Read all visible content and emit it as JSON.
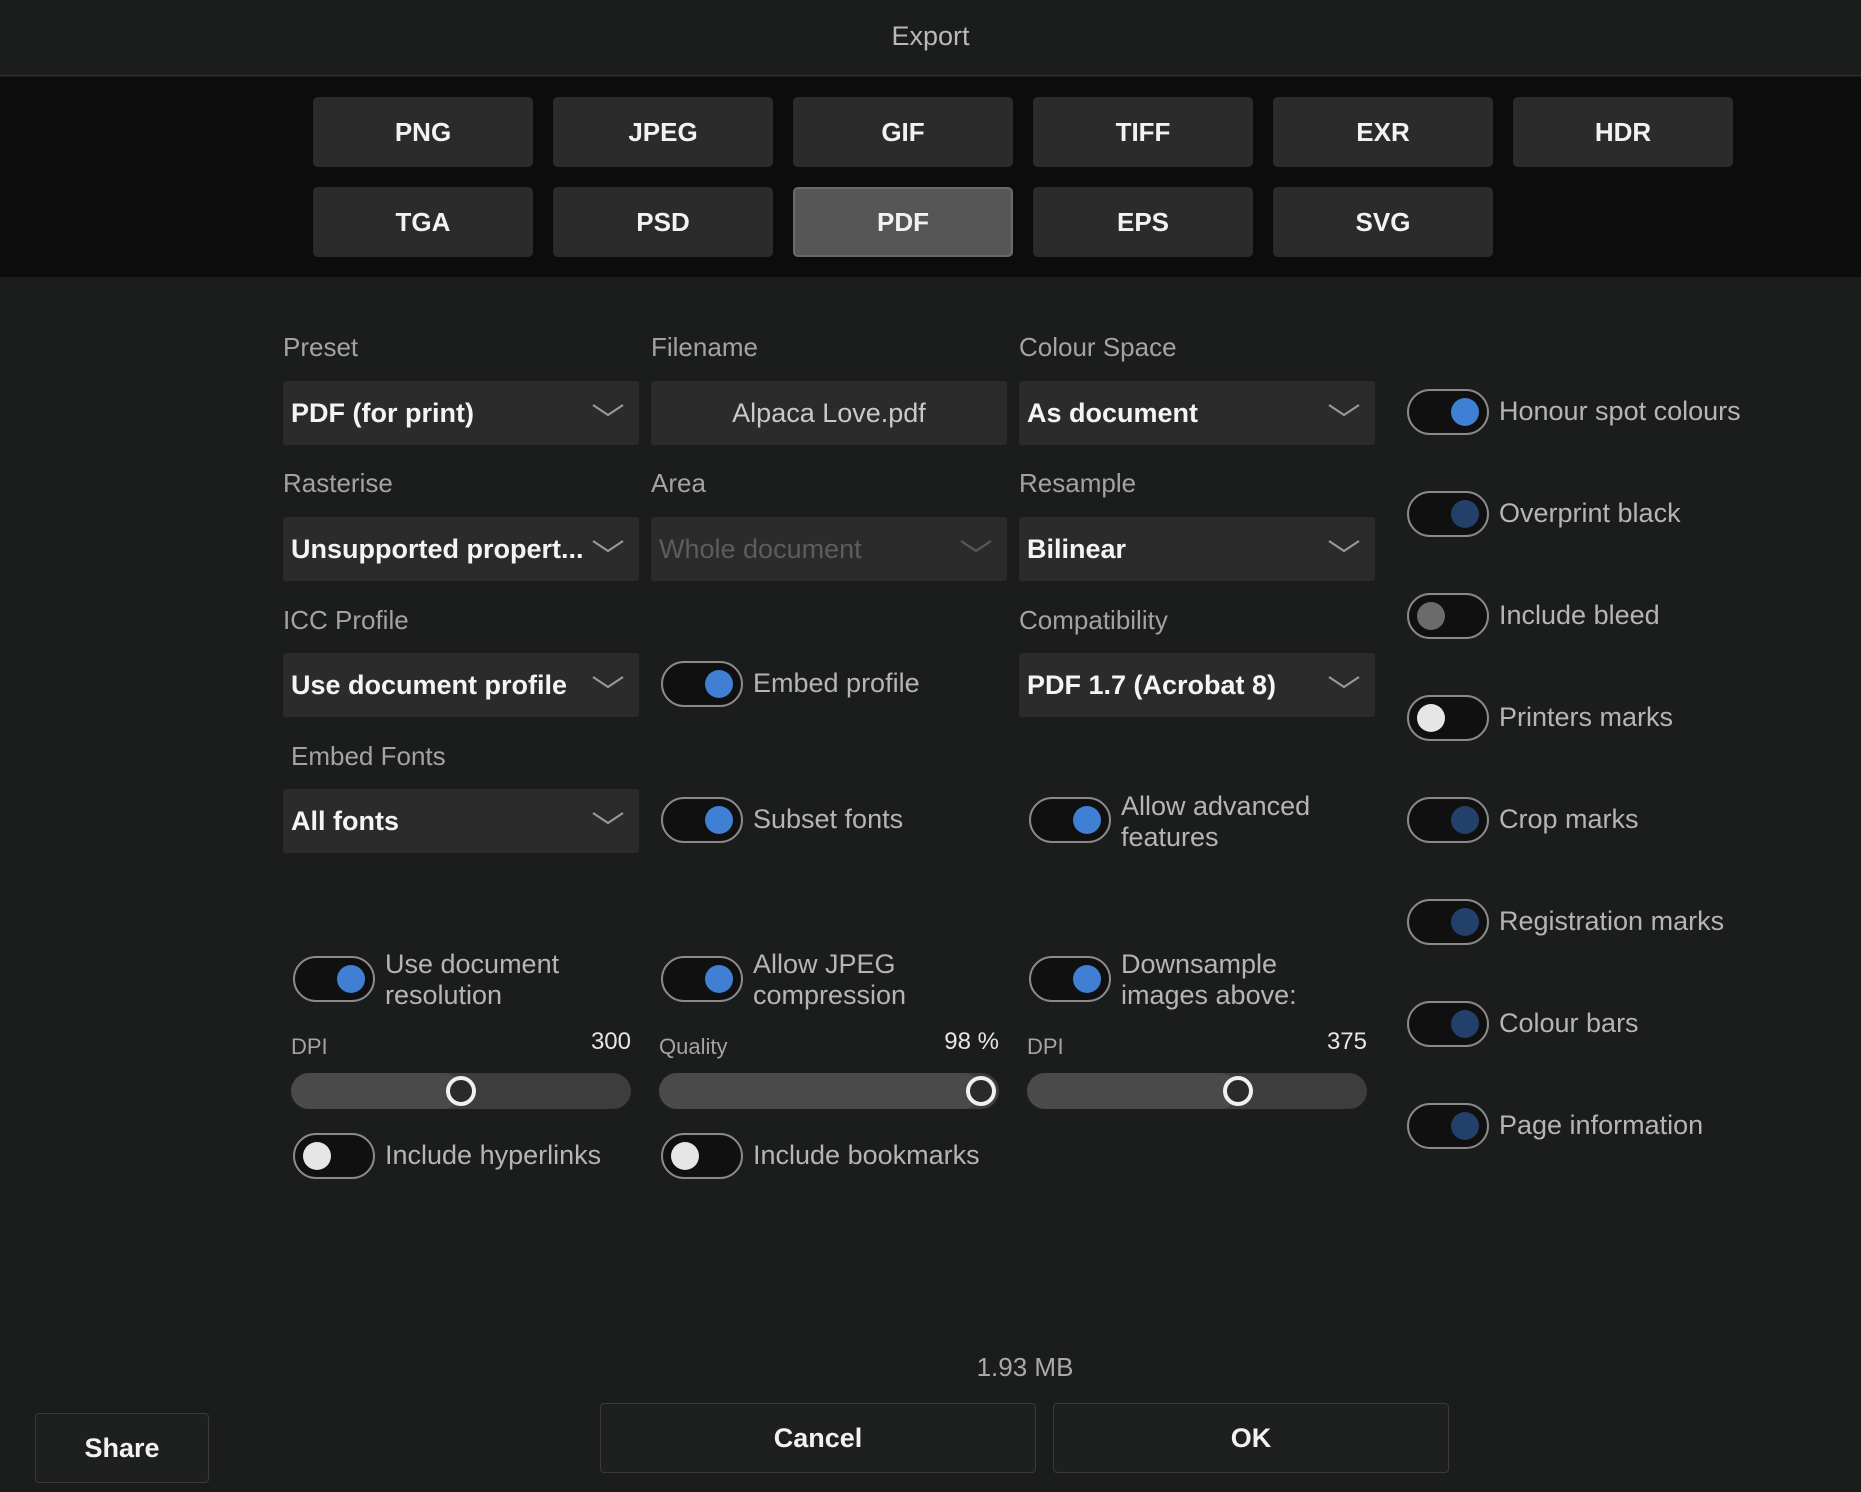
{
  "window": {
    "title": "Export"
  },
  "formats": {
    "row1": [
      "PNG",
      "JPEG",
      "GIF",
      "TIFF",
      "EXR",
      "HDR"
    ],
    "row2": [
      "TGA",
      "PSD",
      "PDF",
      "EPS",
      "SVG"
    ],
    "selected": "PDF"
  },
  "fields": {
    "preset": {
      "label": "Preset",
      "value": "PDF (for print)"
    },
    "filename": {
      "label": "Filename",
      "value": "Alpaca Love.pdf"
    },
    "colour_space": {
      "label": "Colour Space",
      "value": "As document"
    },
    "rasterise": {
      "label": "Rasterise",
      "value": "Unsupported propert..."
    },
    "area": {
      "label": "Area",
      "value": "Whole document"
    },
    "resample": {
      "label": "Resample",
      "value": "Bilinear"
    },
    "icc_profile": {
      "label": "ICC Profile",
      "value": "Use document profile"
    },
    "compatibility": {
      "label": "Compatibility",
      "value": "PDF 1.7 (Acrobat 8)"
    },
    "embed_fonts": {
      "label": "Embed Fonts",
      "value": "All fonts"
    }
  },
  "toggles": {
    "embed_profile": {
      "label": "Embed profile",
      "state": "on"
    },
    "subset_fonts": {
      "label": "Subset fonts",
      "state": "on"
    },
    "allow_advanced": {
      "line1": "Allow advanced",
      "line2": "features",
      "state": "on"
    },
    "use_doc_res": {
      "line1": "Use document",
      "line2": "resolution",
      "state": "on"
    },
    "allow_jpeg": {
      "line1": "Allow JPEG",
      "line2": "compression",
      "state": "on"
    },
    "downsample": {
      "line1": "Downsample",
      "line2": "images above:",
      "state": "on"
    },
    "include_hyperlinks": {
      "label": "Include hyperlinks",
      "state": "off"
    },
    "include_bookmarks": {
      "label": "Include bookmarks",
      "state": "off"
    }
  },
  "sliders": {
    "dpi": {
      "label": "DPI",
      "value": "300",
      "fraction": 0.5
    },
    "quality": {
      "label": "Quality",
      "value": "98 %",
      "fraction": 0.98
    },
    "downsample_dpi": {
      "label": "DPI",
      "value": "375",
      "fraction": 0.62
    }
  },
  "right_options": [
    {
      "label": "Honour spot colours",
      "state": "on"
    },
    {
      "label": "Overprint black",
      "state": "dim"
    },
    {
      "label": "Include bleed",
      "state": "offgray"
    },
    {
      "label": "Printers marks",
      "state": "off"
    },
    {
      "label": "Crop marks",
      "state": "dim"
    },
    {
      "label": "Registration marks",
      "state": "dim"
    },
    {
      "label": "Colour bars",
      "state": "dim"
    },
    {
      "label": "Page information",
      "state": "dim"
    }
  ],
  "footer": {
    "file_size": "1.93 MB",
    "share_label": "Share",
    "cancel_label": "Cancel",
    "ok_label": "OK"
  },
  "colors": {
    "accent": "#3f7fd4",
    "accent_dim": "#23406a",
    "background": "#1b1c1c"
  }
}
